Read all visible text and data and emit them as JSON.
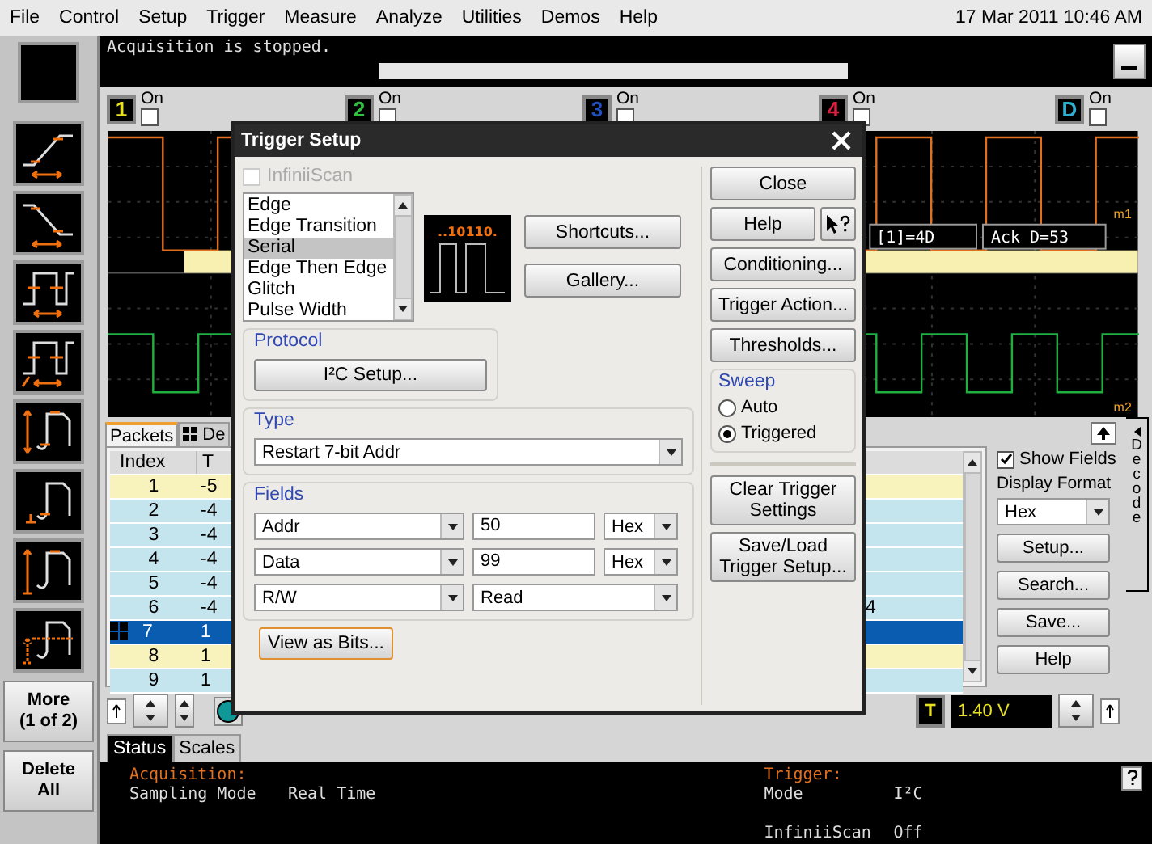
{
  "menu": [
    "File",
    "Control",
    "Setup",
    "Trigger",
    "Measure",
    "Analyze",
    "Utilities",
    "Demos",
    "Help"
  ],
  "datetime": "17 Mar 2011 10:46 AM",
  "message": "Acquisition is stopped.",
  "progress": {
    "level": 0
  },
  "channels": [
    {
      "label": "1",
      "on_label": "On",
      "checked": false,
      "color": "#e8e020"
    },
    {
      "label": "2",
      "on_label": "On",
      "checked": false,
      "color": "#30c040"
    },
    {
      "label": "3",
      "on_label": "On",
      "checked": false,
      "color": "#2050c0"
    },
    {
      "label": "4",
      "on_label": "On",
      "checked": false,
      "color": "#e02040"
    },
    {
      "label": "D",
      "on_label": "On",
      "checked": false,
      "color": "#30b0d0"
    }
  ],
  "measurements": [
    {
      "kind": "rise"
    },
    {
      "kind": "fall"
    },
    {
      "kind": "width"
    },
    {
      "kind": "period"
    },
    {
      "kind": "amplitude"
    },
    {
      "kind": "base"
    },
    {
      "kind": "top"
    },
    {
      "kind": "middle"
    }
  ],
  "more_button": [
    "More",
    "(1 of 2)"
  ],
  "delete_button": [
    "Delete",
    "All"
  ],
  "waveform": {
    "decode_labels": [
      "[1]=4D",
      "Ack D=53"
    ],
    "markers": [
      "m1",
      "m2"
    ]
  },
  "decode": {
    "tabs": [
      {
        "label": "Packets",
        "selected": true
      },
      {
        "label": "De",
        "selected": false
      }
    ],
    "columns": [
      "Index",
      "T"
    ],
    "rows": [
      {
        "cells": [
          "1",
          "-5"
        ],
        "color": "#f8f2bc",
        "selected": false
      },
      {
        "cells": [
          "2",
          "-4"
        ],
        "color": "#c4e4ee",
        "selected": false
      },
      {
        "cells": [
          "3",
          "-4"
        ],
        "color": "#c4e4ee",
        "selected": false
      },
      {
        "cells": [
          "4",
          "-4"
        ],
        "color": "#c4e4ee",
        "selected": false
      },
      {
        "cells": [
          "5",
          "-4"
        ],
        "color": "#c4e4ee",
        "selected": false
      },
      {
        "cells": [
          "6",
          "-4",
          "4"
        ],
        "color": "#c4e4ee",
        "selected": false
      },
      {
        "cells": [
          "7",
          "1"
        ],
        "selected": true
      },
      {
        "cells": [
          "8",
          "1"
        ],
        "color": "#f8f2bc",
        "selected": false
      },
      {
        "cells": [
          "9",
          "1"
        ],
        "color": "#c4e4ee",
        "selected": false
      }
    ],
    "show_fields": {
      "label": "Show Fields",
      "checked": true
    },
    "display_format": {
      "label": "Display Format",
      "value": "Hex"
    },
    "buttons": [
      "Setup...",
      "Search...",
      "Save...",
      "Help"
    ],
    "side_tab": "Decode"
  },
  "trigger_level": {
    "label": "T",
    "value": "1.40 V"
  },
  "status_tabs": [
    {
      "label": "Status",
      "selected": true
    },
    {
      "label": "Scales",
      "selected": false
    }
  ],
  "status": {
    "acquisition": {
      "heading": "Acquisition:",
      "rows": [
        {
          "name": "Sampling Mode",
          "value": "Real Time"
        }
      ]
    },
    "trigger": {
      "heading": "Trigger:",
      "rows": [
        {
          "name": "Mode",
          "value": "I²C"
        },
        {
          "name": "InfiniiScan",
          "value": "Off"
        }
      ]
    }
  },
  "dialog": {
    "title": "Trigger Setup",
    "infiniiscan": {
      "label": "InfiniiScan",
      "checked": false,
      "disabled": true
    },
    "trigger_types": [
      {
        "label": "Edge",
        "selected": false
      },
      {
        "label": "Edge Transition",
        "selected": false
      },
      {
        "label": "Serial",
        "selected": true
      },
      {
        "label": "Edge Then Edge",
        "selected": false
      },
      {
        "label": "Glitch",
        "selected": false
      },
      {
        "label": "Pulse Width",
        "selected": false
      }
    ],
    "preview_bits": "..10110.",
    "shortcuts_button": "Shortcuts...",
    "gallery_button": "Gallery...",
    "protocol": {
      "legend": "Protocol",
      "button": "I²C Setup..."
    },
    "type": {
      "legend": "Type",
      "value": "Restart 7-bit Addr"
    },
    "fields": {
      "legend": "Fields",
      "rows": [
        {
          "kind": "value",
          "name": "Addr",
          "value": "50",
          "format": "Hex"
        },
        {
          "kind": "value",
          "name": "Data",
          "value": "99",
          "format": "Hex"
        },
        {
          "kind": "choice",
          "name": "R/W",
          "value": "Read"
        }
      ]
    },
    "view_bits_button": "View as Bits...",
    "close_button": "Close",
    "help_button": "Help",
    "side_buttons": [
      "Conditioning...",
      "Trigger Action...",
      "Thresholds..."
    ],
    "sweep": {
      "legend": "Sweep",
      "options": [
        {
          "label": "Auto",
          "selected": false
        },
        {
          "label": "Triggered",
          "selected": true
        }
      ]
    },
    "clear_button": [
      "Clear Trigger",
      "Settings"
    ],
    "save_button": [
      "Save/Load",
      "Trigger Setup..."
    ]
  }
}
